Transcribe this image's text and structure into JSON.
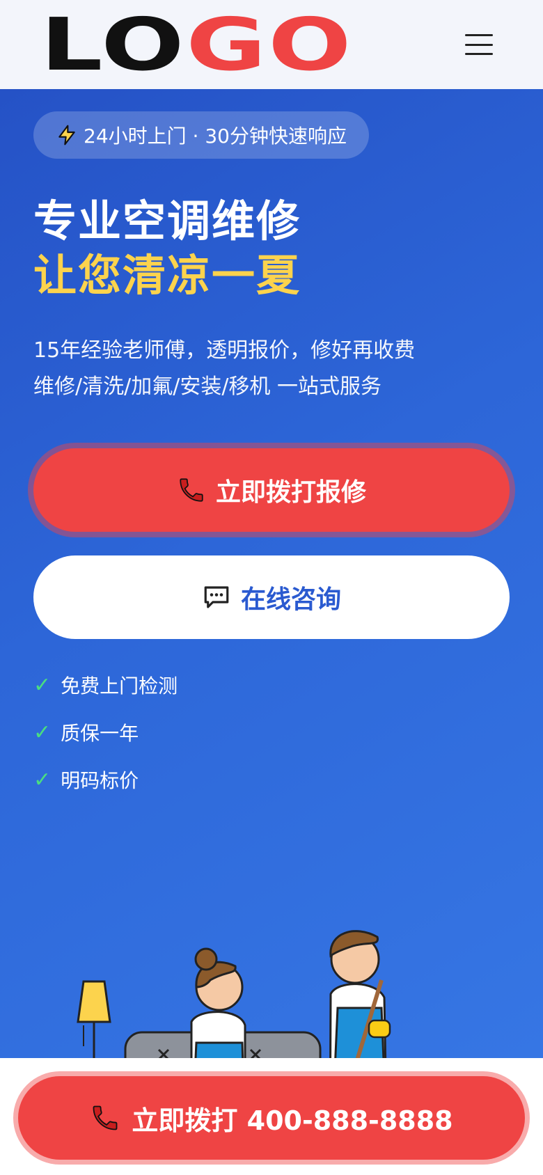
{
  "header": {
    "logo_part1": "LO",
    "logo_part2": "GO",
    "menu_icon": "hamburger-icon"
  },
  "hero": {
    "badge_text": "24小时上门 · 30分钟快速响应",
    "badge_icon": "lightning-icon",
    "title_line1": "专业空调维修",
    "title_line2": "让您清凉一夏",
    "subtitle_line1": "15年经验老师傅，透明报价，修好再收费",
    "subtitle_line2": "维修/清洗/加氟/安装/移机 一站式服务",
    "call_button": "立即拨打报修",
    "call_icon": "phone-icon",
    "chat_button": "在线咨询",
    "chat_icon": "chat-bubble-icon",
    "features": [
      "免费上门检测",
      "质保一年",
      "明码标价"
    ],
    "feature_check": "✓"
  },
  "footer": {
    "call_label": "立即拨打 400-888-8888",
    "call_icon": "phone-icon"
  },
  "colors": {
    "brand_blue": "#2a5ad0",
    "accent_red": "#ef4444",
    "highlight_yellow": "#fcd34d",
    "check_green": "#4ade80"
  }
}
